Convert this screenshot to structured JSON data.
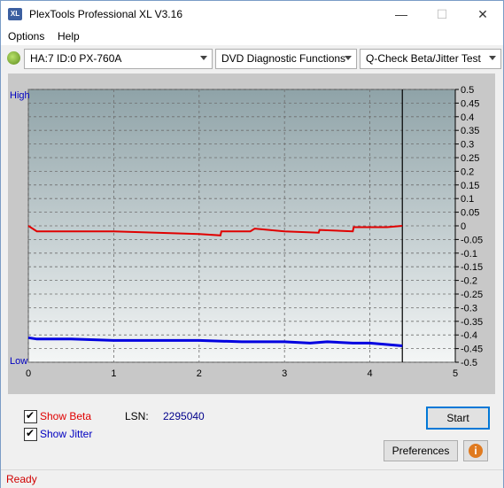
{
  "window": {
    "app_icon_text": "XL",
    "title": "PlexTools Professional XL V3.16",
    "controls": {
      "minimize": "—",
      "maximize": "☐",
      "close": "✕"
    }
  },
  "menu": {
    "items": [
      {
        "label": "Options"
      },
      {
        "label": "Help"
      }
    ]
  },
  "toolbar": {
    "drive": "HA:7 ID:0  PX-760A",
    "function": "DVD Diagnostic Functions",
    "test": "Q-Check Beta/Jitter Test"
  },
  "chart_data": {
    "type": "line",
    "title": "",
    "left_axis_labels": {
      "high": "High",
      "low": "Low"
    },
    "xlim": [
      0,
      5
    ],
    "x_ticks": [
      "0",
      "1",
      "2",
      "3",
      "4",
      "5"
    ],
    "ylim": [
      -0.5,
      0.5
    ],
    "y_ticks": [
      "0.5",
      "0.45",
      "0.4",
      "0.35",
      "0.3",
      "0.25",
      "0.2",
      "0.15",
      "0.1",
      "0.05",
      "0",
      "-0.05",
      "-0.1",
      "-0.15",
      "-0.2",
      "-0.25",
      "-0.3",
      "-0.35",
      "-0.4",
      "-0.45",
      "-0.5"
    ],
    "grid": true,
    "marker_x": 4.38,
    "series": [
      {
        "color": "#e00000",
        "x": [
          0,
          0.1,
          0.5,
          1.0,
          1.5,
          2.0,
          2.25,
          2.26,
          2.6,
          2.65,
          3.0,
          3.4,
          3.41,
          3.8,
          3.81,
          4.2,
          4.38
        ],
        "y": [
          0.0,
          -0.02,
          -0.02,
          -0.02,
          -0.025,
          -0.03,
          -0.035,
          -0.02,
          -0.02,
          -0.01,
          -0.02,
          -0.025,
          -0.015,
          -0.02,
          -0.005,
          -0.005,
          0.0
        ]
      },
      {
        "color": "#0000e0",
        "x": [
          0,
          0.1,
          0.5,
          1.0,
          1.5,
          2.0,
          2.5,
          3.0,
          3.3,
          3.5,
          3.8,
          4.0,
          4.2,
          4.38
        ],
        "y": [
          -0.41,
          -0.415,
          -0.415,
          -0.42,
          -0.42,
          -0.42,
          -0.425,
          -0.425,
          -0.43,
          -0.425,
          -0.43,
          -0.43,
          -0.435,
          -0.44
        ]
      }
    ]
  },
  "options": {
    "show_beta": {
      "label": "Show Beta",
      "checked": true,
      "color": "#e00000"
    },
    "show_jitter": {
      "label": "Show Jitter",
      "checked": true,
      "color": "#0000c0"
    }
  },
  "lsn": {
    "label": "LSN:",
    "value": "2295040"
  },
  "buttons": {
    "start": "Start",
    "preferences": "Preferences",
    "info": "i"
  },
  "status": {
    "text": "Ready",
    "color": "#d00000"
  }
}
